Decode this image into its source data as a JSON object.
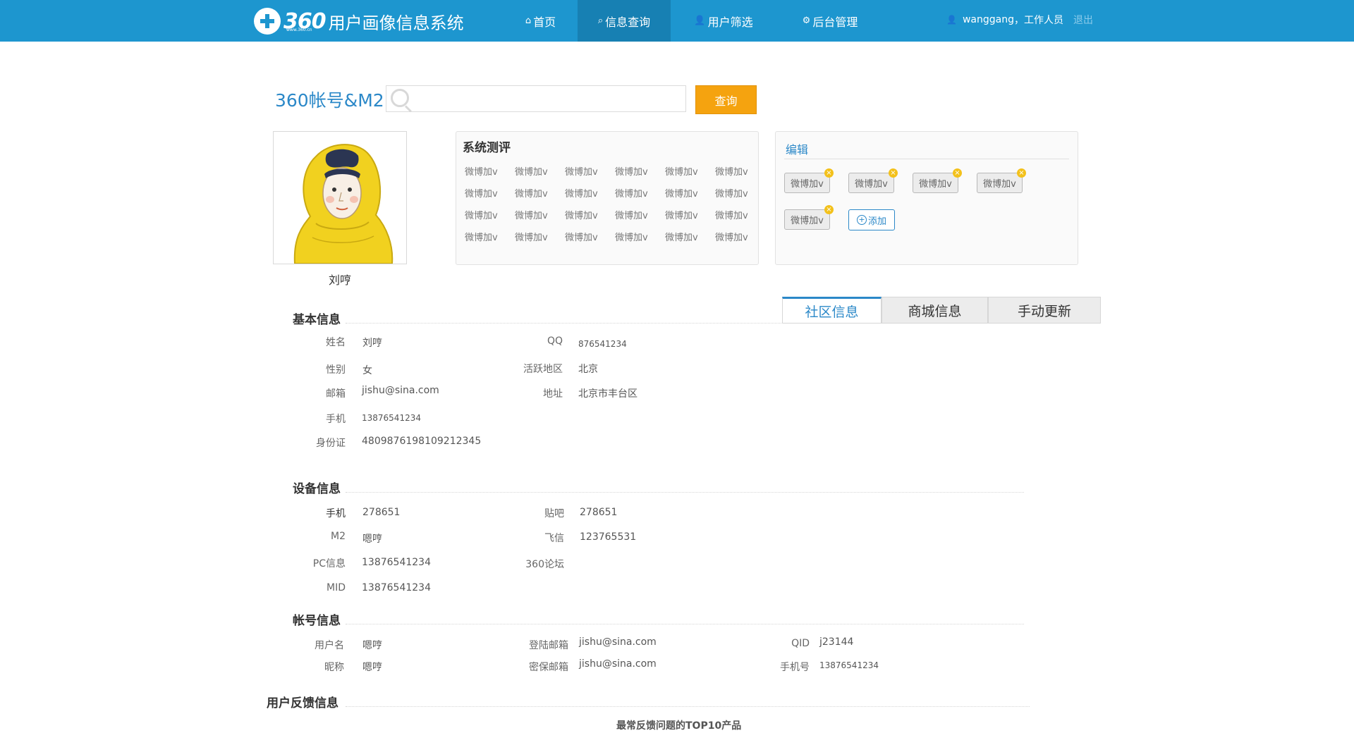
{
  "app": {
    "logo_text": "360",
    "logo_sub": "www.360.cn",
    "title": "用户画像信息系统"
  },
  "nav": {
    "items": [
      {
        "label": "首页",
        "icon": "home-icon"
      },
      {
        "label": "信息查询",
        "icon": "search-info-icon",
        "active": true
      },
      {
        "label": "用户筛选",
        "icon": "user-filter-icon"
      },
      {
        "label": "后台管理",
        "icon": "gear-icon"
      }
    ]
  },
  "user": {
    "name": "wanggang",
    "role": "工作人员",
    "logout": "退出"
  },
  "search": {
    "label": "360帐号&M2",
    "value": "",
    "placeholder": "",
    "button": "查询"
  },
  "profile": {
    "name": "刘哼"
  },
  "evaluation": {
    "title": "系统测评",
    "tags": [
      "微博加v",
      "微博加v",
      "微博加v",
      "微博加v",
      "微博加v",
      "微博加v",
      "微博加v",
      "微博加v",
      "微博加v",
      "微博加v",
      "微博加v",
      "微博加v",
      "微博加v",
      "微博加v",
      "微博加v",
      "微博加v",
      "微博加v",
      "微博加v",
      "微博加v",
      "微博加v",
      "微博加v",
      "微博加v",
      "微博加v",
      "微博加v"
    ]
  },
  "edit": {
    "title": "编辑",
    "tags": [
      "微博加v",
      "微博加v",
      "微博加v",
      "微博加v",
      "微博加v"
    ],
    "remove_glyph": "×",
    "add_label": "添加"
  },
  "tabs": [
    {
      "label": "社区信息",
      "active": true
    },
    {
      "label": "商城信息"
    },
    {
      "label": "手动更新"
    }
  ],
  "basic_info": {
    "title": "基本信息",
    "name_label": "姓名",
    "name": "刘哼",
    "qq_label": "QQ",
    "qq": "876541234",
    "gender_label": "性别",
    "gender": "女",
    "area_label": "活跃地区",
    "area": "北京",
    "email_label": "邮箱",
    "email": "jishu@sina.com",
    "address_label": "地址",
    "address": "北京市丰台区",
    "phone_label": "手机",
    "phone": "13876541234",
    "id_label": "身份证",
    "id_card": "4809876198109212345"
  },
  "device_info": {
    "title": "设备信息",
    "phone_label": "手机",
    "phone": "278651",
    "tieba_label": "贴吧",
    "tieba": "278651",
    "m2_label": "M2",
    "m2": "嗯哼",
    "fetion_label": "飞信",
    "fetion": "123765531",
    "pc_label": "PC信息",
    "pc": "13876541234",
    "forum_label": "360论坛",
    "forum": "",
    "mid_label": "MID",
    "mid": "13876541234"
  },
  "account_info": {
    "title": "帐号信息",
    "username_label": "用户名",
    "username": "嗯哼",
    "login_email_label": "登陆邮箱",
    "login_email": "jishu@sina.com",
    "qid_label": "QID",
    "qid": "j23144",
    "nickname_label": "昵称",
    "nickname": "嗯哼",
    "secure_email_label": "密保邮箱",
    "secure_email": "jishu@sina.com",
    "mobile_label": "手机号",
    "mobile": "13876541234"
  },
  "feedback": {
    "title": "用户反馈信息",
    "top10_title": "最常反馈问题的TOP10产品"
  },
  "colors": {
    "brand": "#1d96cf",
    "nav_active": "#1780b3",
    "accent_blue": "#2b88c8",
    "search_button": "#f5a30f",
    "tag_remove": "#f3c11b"
  }
}
